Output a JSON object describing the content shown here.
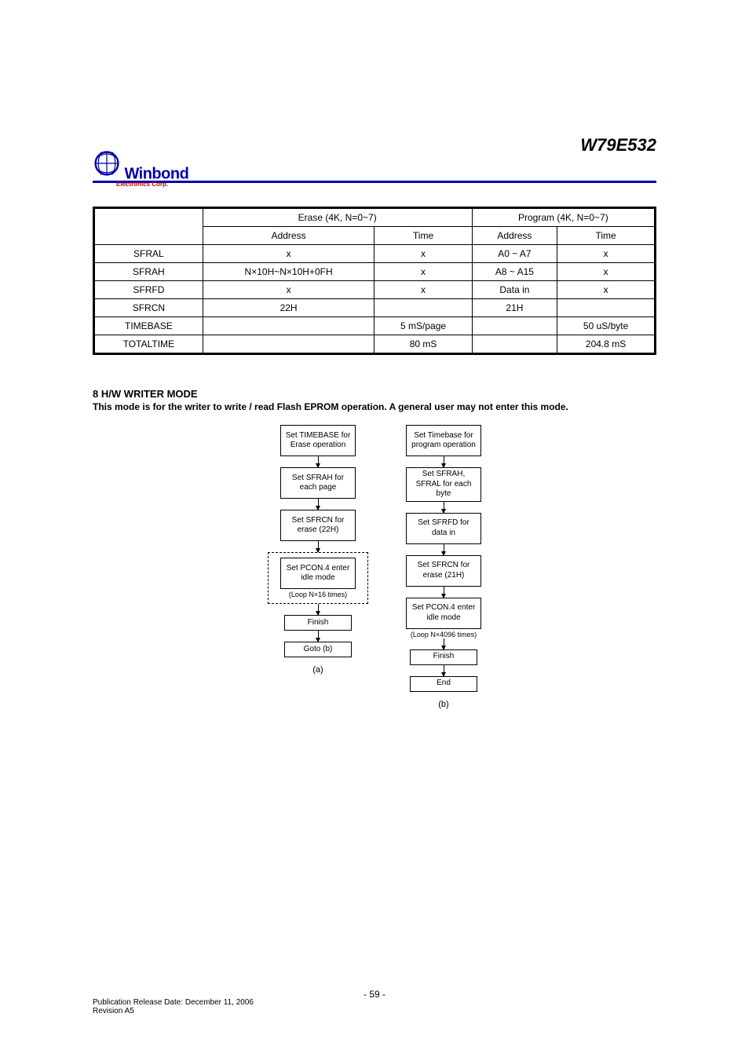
{
  "header": {
    "brand_main": "Winbond",
    "brand_sub": "Electronics Corp.",
    "part_number": "W79E532"
  },
  "table": {
    "headers": {
      "blank": "",
      "erase": "Erase (4K, N=0~7)",
      "program": "Program (4K, N=0~7)",
      "erase_time_h": "Time",
      "erase_addr_h": "Address",
      "prog_time_h": "Time",
      "prog_addr_h": "Address"
    },
    "rows": [
      {
        "label": "SFRAL",
        "e_addr": "x",
        "e_time": "x",
        "p_addr": "A0 ~ A7",
        "p_time": "x"
      },
      {
        "label": "SFRAH",
        "e_addr": "N×10H~N×10H+0FH",
        "e_time": "x",
        "p_addr": "A8 ~ A15",
        "p_time": "x"
      },
      {
        "label": "SFRFD",
        "e_addr": "x",
        "e_time": "x",
        "p_addr": "Data in",
        "p_time": "x"
      },
      {
        "label": "SFRCN",
        "e_addr": "22H",
        "e_time": "",
        "p_addr": "21H",
        "p_time": ""
      },
      {
        "label": "TIMEBASE",
        "e_addr": "",
        "e_time": "5 mS/page",
        "p_addr": "",
        "p_time": "50 uS/byte"
      },
      {
        "label": "TOTALTIME",
        "e_addr": "",
        "e_time": "80 mS",
        "p_addr": "",
        "p_time": "204.8 mS"
      }
    ]
  },
  "section": {
    "heading": "8 H/W WRITER MODE",
    "text": "This mode is for the writer to write / read Flash EPROM operation. A general user may not enter this mode."
  },
  "flowA": {
    "caption": "(a)",
    "b1": "Set TIMEBASE for Erase operation",
    "b2": "Set SFRAH for each page",
    "b3": "Set SFRCN for erase (22H)",
    "b4": "Set PCON.4 enter idle mode",
    "b4_note": "(Loop N×16 times)",
    "b5": "Finish",
    "b6": "Goto (b)"
  },
  "flowB": {
    "caption": "(b)",
    "b1": "Set Timebase for program operation",
    "b2": "Set SFRAH, SFRAL for each byte",
    "b3": "Set SFRFD for data in",
    "b4": "Set SFRCN for erase (21H)",
    "b5": "Set PCON.4 enter idle mode",
    "b5_note": "(Loop N×4096 times)",
    "b6": "Finish",
    "b7": "End"
  },
  "footer": {
    "page_num": "- 59 -",
    "pub_line": "Publication Release Date: December 11, 2006",
    "rev_line": "Revision A5"
  }
}
